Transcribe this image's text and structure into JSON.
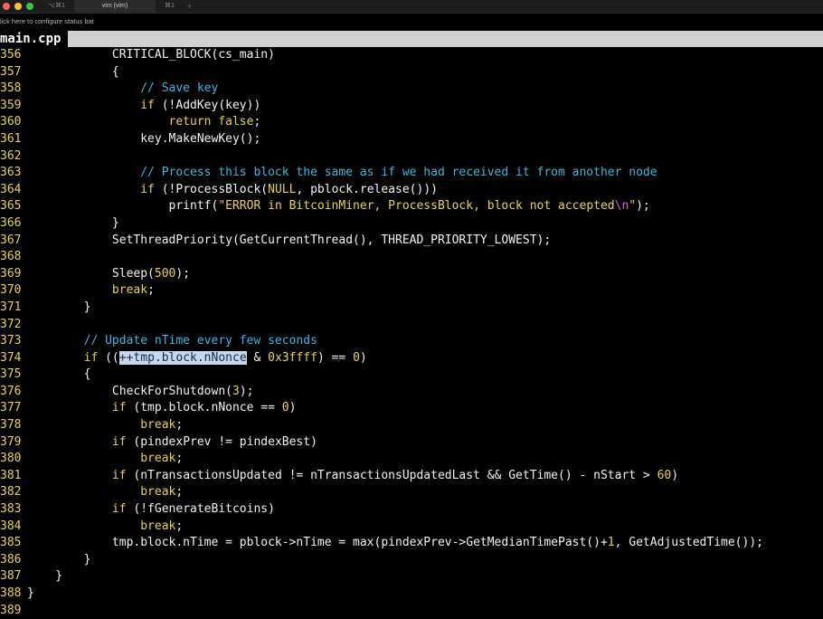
{
  "window": {
    "tabs": [
      "⌥⌘1",
      "vim (vim)",
      "⌘1",
      "+"
    ]
  },
  "status_bar": {
    "text": "lick here to configure status bar"
  },
  "file": {
    "name": "main.cpp"
  },
  "colors": {
    "line_number": "#e8d44d",
    "keyword": "#e8d44d",
    "comment": "#3fb6e0",
    "escape": "#d062d8",
    "background": "#000000",
    "selection": "#c7d8ee"
  },
  "lines": [
    {
      "n": "356",
      "segs": [
        [
          "",
          "            CRITICAL_BLOCK(cs_main)"
        ]
      ]
    },
    {
      "n": "357",
      "segs": [
        [
          "",
          "            {"
        ]
      ]
    },
    {
      "n": "358",
      "segs": [
        [
          "cm",
          "                // Save key"
        ]
      ]
    },
    {
      "n": "359",
      "segs": [
        [
          "kw",
          "                if"
        ],
        [
          "",
          " (!AddKey(key))"
        ]
      ]
    },
    {
      "n": "360",
      "segs": [
        [
          "kw",
          "                    return false"
        ],
        [
          "",
          ";"
        ]
      ]
    },
    {
      "n": "361",
      "segs": [
        [
          "",
          "                key.MakeNewKey();"
        ]
      ]
    },
    {
      "n": "362",
      "segs": []
    },
    {
      "n": "363",
      "segs": [
        [
          "cm",
          "                // Process this block the same as if we had received it from another node"
        ]
      ]
    },
    {
      "n": "364",
      "segs": [
        [
          "kw",
          "                if"
        ],
        [
          "",
          " (!ProcessBlock("
        ],
        [
          "kw",
          "NULL"
        ],
        [
          "",
          ", pblock.release()))"
        ]
      ]
    },
    {
      "n": "365",
      "segs": [
        [
          "",
          "                    printf("
        ],
        [
          "st",
          "\"ERROR in BitcoinMiner, ProcessBlock, block not accepted"
        ],
        [
          "esc",
          "\\n"
        ],
        [
          "st",
          "\""
        ],
        [
          "",
          ");"
        ]
      ]
    },
    {
      "n": "366",
      "segs": [
        [
          "",
          "            }"
        ]
      ]
    },
    {
      "n": "367",
      "segs": [
        [
          "",
          "            SetThreadPriority(GetCurrentThread(), THREAD_PRIORITY_LOWEST);"
        ]
      ]
    },
    {
      "n": "368",
      "segs": []
    },
    {
      "n": "369",
      "segs": [
        [
          "",
          "            Sleep("
        ],
        [
          "num",
          "500"
        ],
        [
          "",
          ");"
        ]
      ]
    },
    {
      "n": "370",
      "segs": [
        [
          "kw",
          "            break"
        ],
        [
          "",
          ";"
        ]
      ]
    },
    {
      "n": "371",
      "segs": [
        [
          "",
          "        }"
        ]
      ]
    },
    {
      "n": "372",
      "segs": []
    },
    {
      "n": "373",
      "segs": [
        [
          "cm",
          "        // Update nTime every few seconds"
        ]
      ]
    },
    {
      "n": "374",
      "segs": [
        [
          "kw",
          "        if"
        ],
        [
          "",
          " (("
        ],
        [
          "sel",
          "++tmp.block.nNonce"
        ],
        [
          "",
          " & "
        ],
        [
          "num",
          "0x3ffff"
        ],
        [
          "",
          ") == "
        ],
        [
          "num",
          "0"
        ],
        [
          "",
          ")"
        ]
      ]
    },
    {
      "n": "375",
      "segs": [
        [
          "",
          "        {"
        ]
      ]
    },
    {
      "n": "376",
      "segs": [
        [
          "",
          "            CheckForShutdown("
        ],
        [
          "num",
          "3"
        ],
        [
          "",
          ");"
        ]
      ]
    },
    {
      "n": "377",
      "segs": [
        [
          "kw",
          "            if"
        ],
        [
          "",
          " (tmp.block.nNonce == "
        ],
        [
          "num",
          "0"
        ],
        [
          "",
          ")"
        ]
      ]
    },
    {
      "n": "378",
      "segs": [
        [
          "kw",
          "                break"
        ],
        [
          "",
          ";"
        ]
      ]
    },
    {
      "n": "379",
      "segs": [
        [
          "kw",
          "            if"
        ],
        [
          "",
          " (pindexPrev != pindexBest)"
        ]
      ]
    },
    {
      "n": "380",
      "segs": [
        [
          "kw",
          "                break"
        ],
        [
          "",
          ";"
        ]
      ]
    },
    {
      "n": "381",
      "segs": [
        [
          "kw",
          "            if"
        ],
        [
          "",
          " (nTransactionsUpdated != nTransactionsUpdatedLast && GetTime() - nStart > "
        ],
        [
          "num",
          "60"
        ],
        [
          "",
          ")"
        ]
      ]
    },
    {
      "n": "382",
      "segs": [
        [
          "kw",
          "                break"
        ],
        [
          "",
          ";"
        ]
      ]
    },
    {
      "n": "383",
      "segs": [
        [
          "kw",
          "            if"
        ],
        [
          "",
          " (!fGenerateBitcoins)"
        ]
      ]
    },
    {
      "n": "384",
      "segs": [
        [
          "kw",
          "                break"
        ],
        [
          "",
          ";"
        ]
      ]
    },
    {
      "n": "385",
      "segs": [
        [
          "",
          "            tmp.block.nTime = pblock->nTime = max(pindexPrev->GetMedianTimePast()+"
        ],
        [
          "num",
          "1"
        ],
        [
          "",
          ", GetAdjustedTime());"
        ]
      ]
    },
    {
      "n": "386",
      "segs": [
        [
          "",
          "        }"
        ]
      ]
    },
    {
      "n": "387",
      "segs": [
        [
          "",
          "    }"
        ]
      ]
    },
    {
      "n": "388",
      "segs": [
        [
          "",
          "}"
        ]
      ]
    },
    {
      "n": "389",
      "segs": []
    }
  ]
}
